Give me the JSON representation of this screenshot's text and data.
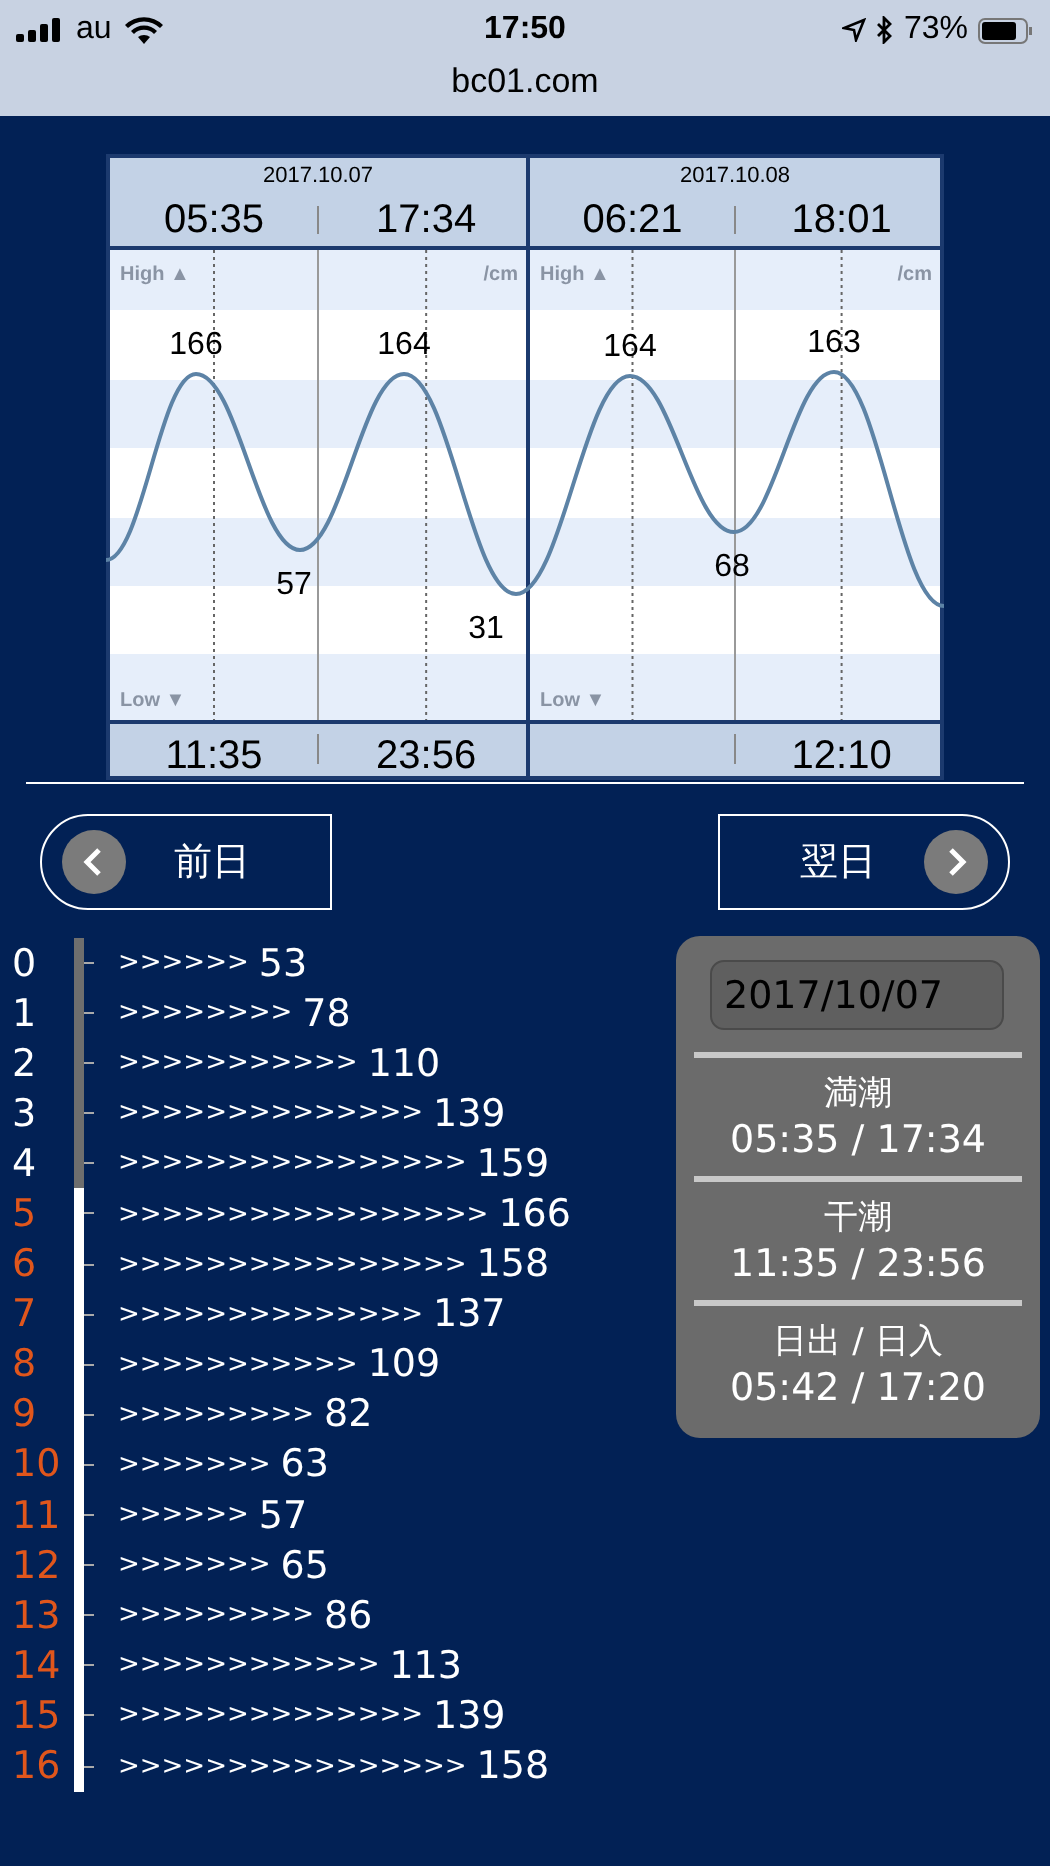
{
  "status_bar": {
    "carrier": "au",
    "time": "17:50",
    "battery": "73%"
  },
  "address_bar": {
    "url": "bc01.com"
  },
  "tide_chart": {
    "days": [
      {
        "date": "2017.10.07",
        "high_am": "05:35",
        "high_pm": "17:34",
        "low_am": "11:35",
        "low_pm": "23:56",
        "high_label": "High ▲",
        "low_label": "Low ▼",
        "unit": "/cm"
      },
      {
        "date": "2017.10.08",
        "high_am": "06:21",
        "high_pm": "18:01",
        "low_pm": "12:10",
        "high_label": "High ▲",
        "low_label": "Low ▼",
        "unit": "/cm"
      }
    ],
    "levels": [
      {
        "value": "166",
        "kind": "high"
      },
      {
        "value": "57",
        "kind": "low"
      },
      {
        "value": "164",
        "kind": "high"
      },
      {
        "value": "31",
        "kind": "low"
      },
      {
        "value": "164",
        "kind": "high"
      },
      {
        "value": "68",
        "kind": "low"
      },
      {
        "value": "163",
        "kind": "high"
      }
    ]
  },
  "nav": {
    "prev": "前日",
    "next": "翌日"
  },
  "hours": [
    {
      "hour": "0",
      "arrows": ">>>>>>",
      "value": "53",
      "past": true
    },
    {
      "hour": "1",
      "arrows": ">>>>>>>>",
      "value": "78",
      "past": true
    },
    {
      "hour": "2",
      "arrows": ">>>>>>>>>>>",
      "value": "110",
      "past": true
    },
    {
      "hour": "3",
      "arrows": ">>>>>>>>>>>>>>",
      "value": "139",
      "past": true
    },
    {
      "hour": "4",
      "arrows": ">>>>>>>>>>>>>>>>",
      "value": "159",
      "past": true
    },
    {
      "hour": "5",
      "arrows": ">>>>>>>>>>>>>>>>>",
      "value": "166",
      "past": false
    },
    {
      "hour": "6",
      "arrows": ">>>>>>>>>>>>>>>>",
      "value": "158",
      "past": false
    },
    {
      "hour": "7",
      "arrows": ">>>>>>>>>>>>>>",
      "value": "137",
      "past": false
    },
    {
      "hour": "8",
      "arrows": ">>>>>>>>>>>",
      "value": "109",
      "past": false
    },
    {
      "hour": "9",
      "arrows": ">>>>>>>>>",
      "value": "82",
      "past": false
    },
    {
      "hour": "10",
      "arrows": ">>>>>>>",
      "value": "63",
      "past": false
    },
    {
      "hour": "11",
      "arrows": ">>>>>>",
      "value": "57",
      "past": false
    },
    {
      "hour": "12",
      "arrows": ">>>>>>>",
      "value": "65",
      "past": false
    },
    {
      "hour": "13",
      "arrows": ">>>>>>>>>",
      "value": "86",
      "past": false
    },
    {
      "hour": "14",
      "arrows": ">>>>>>>>>>>>",
      "value": "113",
      "past": false
    },
    {
      "hour": "15",
      "arrows": ">>>>>>>>>>>>>>",
      "value": "139",
      "past": false
    },
    {
      "hour": "16",
      "arrows": ">>>>>>>>>>>>>>>>",
      "value": "158",
      "past": false
    }
  ],
  "info_panel": {
    "date": "2017/10/07",
    "sections": [
      {
        "label": "満潮",
        "times": "05:35 / 17:34"
      },
      {
        "label": "干潮",
        "times": "11:35 / 23:56"
      },
      {
        "label": "日出 / 日入",
        "times": "05:42 / 17:20"
      }
    ]
  }
}
